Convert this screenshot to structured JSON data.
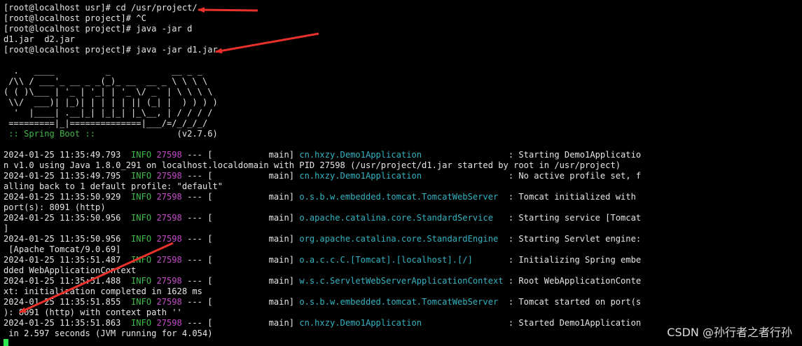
{
  "terminal": {
    "lines": [
      [
        {
          "t": "[root@localhost usr]# cd /usr/project/"
        }
      ],
      [
        {
          "t": "[root@localhost project]# ^C"
        }
      ],
      [
        {
          "t": "[root@localhost project]# java -jar d"
        }
      ],
      [
        {
          "t": "d1.jar  d2.jar"
        }
      ],
      [
        {
          "t": "[root@localhost project]# java -jar d1.jar"
        }
      ],
      [
        {
          "t": ""
        }
      ],
      [
        {
          "t": "  .   ____          _            __ _ _"
        }
      ],
      [
        {
          "t": " /\\\\ / ___'_ __ _ _(_)_ __  __ _ \\ \\ \\ \\"
        }
      ],
      [
        {
          "t": "( ( )\\___ | '_ | '_| | '_ \\/ _` | \\ \\ \\ \\"
        }
      ],
      [
        {
          "t": " \\\\/  ___)| |_)| | | | | || (_| |  ) ) ) )"
        }
      ],
      [
        {
          "t": "  '  |____| .__|_| |_|_| |_\\__, | / / / /"
        }
      ],
      [
        {
          "t": " =========|_|==============|___/=/_/_/_/"
        }
      ],
      [
        {
          "t": " :: Spring Boot ::",
          "c": "green"
        },
        {
          "t": "                (v2.7.6)"
        }
      ],
      [
        {
          "t": ""
        }
      ],
      [
        {
          "t": "2024-01-25 11:35:49.793  "
        },
        {
          "t": "INFO",
          "c": "green"
        },
        {
          "t": " "
        },
        {
          "t": "27598",
          "c": "magenta"
        },
        {
          "t": " --- [           main] "
        },
        {
          "t": "cn.hxzy.Demo1Application                ",
          "c": "cyan"
        },
        {
          "t": " : Starting Demo1Applicatio"
        }
      ],
      [
        {
          "t": "n v1.0 using Java 1.8.0_291 on localhost.localdomain with PID 27598 (/usr/project/d1.jar started by root in /usr/project)"
        }
      ],
      [
        {
          "t": "2024-01-25 11:35:49.795  "
        },
        {
          "t": "INFO",
          "c": "green"
        },
        {
          "t": " "
        },
        {
          "t": "27598",
          "c": "magenta"
        },
        {
          "t": " --- [           main] "
        },
        {
          "t": "cn.hxzy.Demo1Application                ",
          "c": "cyan"
        },
        {
          "t": " : No active profile set, f"
        }
      ],
      [
        {
          "t": "alling back to 1 default profile: \"default\""
        }
      ],
      [
        {
          "t": "2024-01-25 11:35:50.929  "
        },
        {
          "t": "INFO",
          "c": "green"
        },
        {
          "t": " "
        },
        {
          "t": "27598",
          "c": "magenta"
        },
        {
          "t": " --- [           main] "
        },
        {
          "t": "o.s.b.w.embedded.tomcat.TomcatWebServer ",
          "c": "cyan"
        },
        {
          "t": " : Tomcat initialized with"
        }
      ],
      [
        {
          "t": "port(s): 8091 (http)"
        }
      ],
      [
        {
          "t": "2024-01-25 11:35:50.956  "
        },
        {
          "t": "INFO",
          "c": "green"
        },
        {
          "t": " "
        },
        {
          "t": "27598",
          "c": "magenta"
        },
        {
          "t": " --- [           main] "
        },
        {
          "t": "o.apache.catalina.core.StandardService  ",
          "c": "cyan"
        },
        {
          "t": " : Starting service [Tomcat"
        }
      ],
      [
        {
          "t": "]"
        }
      ],
      [
        {
          "t": "2024-01-25 11:35:50.956  "
        },
        {
          "t": "INFO",
          "c": "green"
        },
        {
          "t": " "
        },
        {
          "t": "27598",
          "c": "magenta"
        },
        {
          "t": " --- [           main] "
        },
        {
          "t": "org.apache.catalina.core.StandardEngine ",
          "c": "cyan"
        },
        {
          "t": " : Starting Servlet engine:"
        }
      ],
      [
        {
          "t": " [Apache Tomcat/9.0.69]"
        }
      ],
      [
        {
          "t": "2024-01-25 11:35:51.487  "
        },
        {
          "t": "INFO",
          "c": "green"
        },
        {
          "t": " "
        },
        {
          "t": "27598",
          "c": "magenta"
        },
        {
          "t": " --- [           main] "
        },
        {
          "t": "o.a.c.c.C.[Tomcat].[localhost].[/]      ",
          "c": "cyan"
        },
        {
          "t": " : Initializing Spring embe"
        }
      ],
      [
        {
          "t": "dded WebApplicationContext"
        }
      ],
      [
        {
          "t": "2024-01-25 11:35:51.488  "
        },
        {
          "t": "INFO",
          "c": "green"
        },
        {
          "t": " "
        },
        {
          "t": "27598",
          "c": "magenta"
        },
        {
          "t": " --- [           main] "
        },
        {
          "t": "w.s.c.ServletWebServerApplicationContext",
          "c": "cyan"
        },
        {
          "t": " : Root WebApplicationConte"
        }
      ],
      [
        {
          "t": "xt: initialization completed in 1628 ms"
        }
      ],
      [
        {
          "t": "2024-01-25 11:35:51.855  "
        },
        {
          "t": "INFO",
          "c": "green"
        },
        {
          "t": " "
        },
        {
          "t": "27598",
          "c": "magenta"
        },
        {
          "t": " --- [           main] "
        },
        {
          "t": "o.s.b.w.embedded.tomcat.TomcatWebServer ",
          "c": "cyan"
        },
        {
          "t": " : Tomcat started on port(s"
        }
      ],
      [
        {
          "t": "): 8091 (http) with context path ''"
        }
      ],
      [
        {
          "t": "2024-01-25 11:35:51.863  "
        },
        {
          "t": "INFO",
          "c": "green"
        },
        {
          "t": " "
        },
        {
          "t": "27598",
          "c": "magenta"
        },
        {
          "t": " --- [           main] "
        },
        {
          "t": "cn.hxzy.Demo1Application                ",
          "c": "cyan"
        },
        {
          "t": " : Started Demo1Application"
        }
      ],
      [
        {
          "t": " in 2.597 seconds (JVM running for 4.054)"
        }
      ],
      [
        {
          "t": "",
          "cursor": true
        }
      ]
    ]
  },
  "watermark": {
    "text": "CSDN @孙行者之者行孙"
  },
  "colors": {
    "background": "#000000",
    "text": "#e6e6e6",
    "info": "#3fb94a",
    "pid": "#c34ac7",
    "logger": "#33b3c2",
    "cursor": "#2ee84f",
    "arrow": "#e8312a"
  }
}
